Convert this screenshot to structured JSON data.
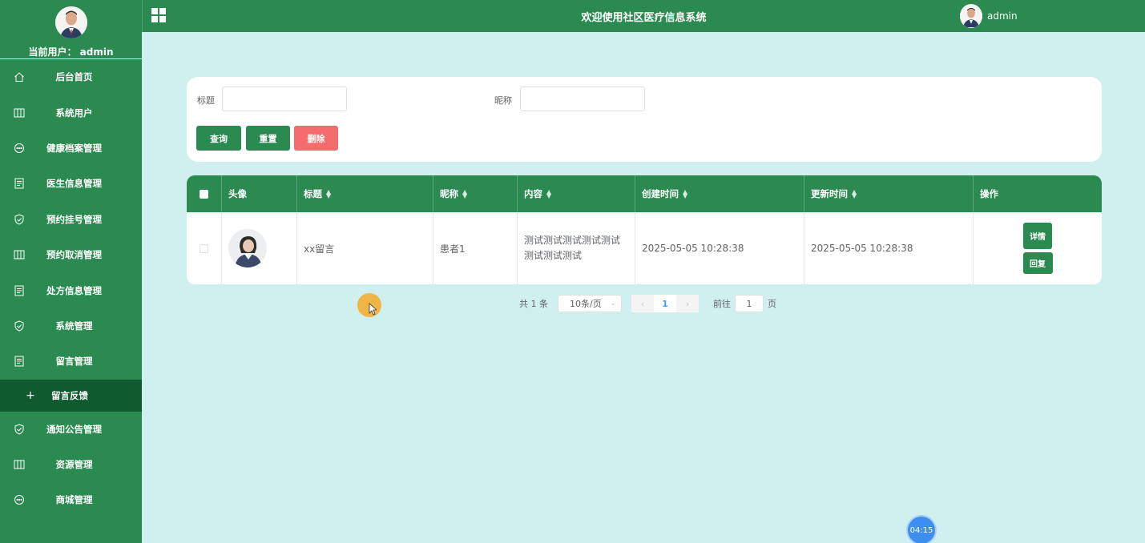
{
  "sidebar": {
    "current_user": "当前用户： admin",
    "items": [
      {
        "label": "后台首页",
        "icon": "home-icon"
      },
      {
        "label": "系统用户",
        "icon": "columns-icon"
      },
      {
        "label": "健康档案管理",
        "icon": "chat-icon"
      },
      {
        "label": "医生信息管理",
        "icon": "document-icon"
      },
      {
        "label": "预约挂号管理",
        "icon": "shield-icon"
      },
      {
        "label": "预约取消管理",
        "icon": "columns-icon"
      },
      {
        "label": "处方信息管理",
        "icon": "document-icon"
      },
      {
        "label": "系统管理",
        "icon": "shield-icon"
      },
      {
        "label": "留言管理",
        "icon": "document-icon"
      },
      {
        "label": "通知公告管理",
        "icon": "shield-icon"
      },
      {
        "label": "资源管理",
        "icon": "columns-icon"
      },
      {
        "label": "商城管理",
        "icon": "chat-icon"
      }
    ],
    "active_sub": {
      "plus": "+",
      "label": "留言反馈"
    }
  },
  "topbar": {
    "title": "欢迎使用社区医疗信息系统",
    "username": "admin"
  },
  "search": {
    "title_label": "标题",
    "title_value": "",
    "nickname_label": "昵称",
    "nickname_value": "",
    "query_button": "查询",
    "reset_button": "重置",
    "delete_button": "删除"
  },
  "table": {
    "headers": [
      "头像",
      "标题",
      "昵称",
      "内容",
      "创建时间",
      "更新时间",
      "操作"
    ],
    "rows": [
      {
        "title": "xx留言",
        "nickname": "患者1",
        "content": "测试测试测试测试测试测试测试测试",
        "created": "2025-05-05 10:28:38",
        "updated": "2025-05-05 10:28:38",
        "detail_button": "详情",
        "reply_button": "回复"
      }
    ]
  },
  "pagination": {
    "total": "共 1 条",
    "page_size": "10条/页",
    "current_page": "1",
    "goto_label": "前往",
    "goto_value": "1",
    "page_suffix": "页"
  },
  "timer": "04:15",
  "colors": {
    "primary": "#2a8a4f",
    "active_sub": "#0f5a2e",
    "delete": "#f56c6c",
    "background": "#d0f0ef"
  }
}
